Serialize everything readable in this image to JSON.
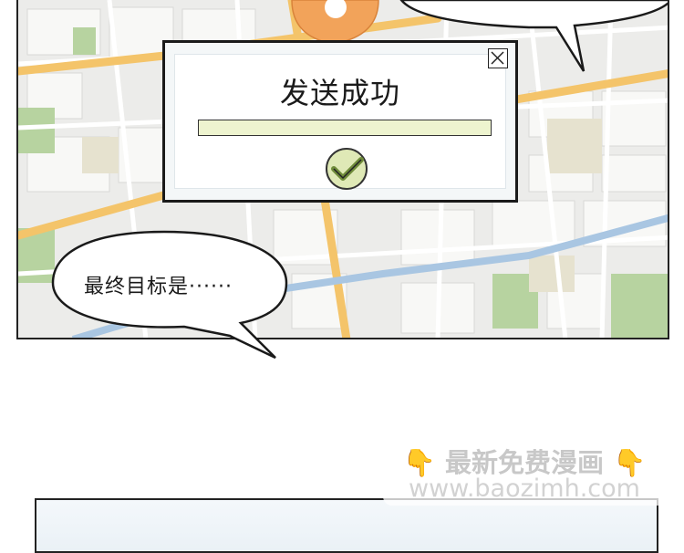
{
  "dialog": {
    "title": "发送成功",
    "close_label": "✕",
    "progress": 1.0,
    "status_icon": "checkmark-icon"
  },
  "speech_bubble": {
    "text": "最终目标是······"
  },
  "watermark": {
    "line1_emoji_left": "👇",
    "line1_text": "最新免费漫画",
    "line1_emoji_right": "👇",
    "line2_text": "www.baozimh.com"
  },
  "colors": {
    "map_background": "#ececea",
    "map_block": "#f8f8f6",
    "map_park": "#b7d3a0",
    "map_road_main": "#f4c46a",
    "map_river": "#a9c6e2",
    "pin": "#f2a35a",
    "progress_fill": "#eef4cf",
    "check_fill": "#dfe9b6"
  }
}
